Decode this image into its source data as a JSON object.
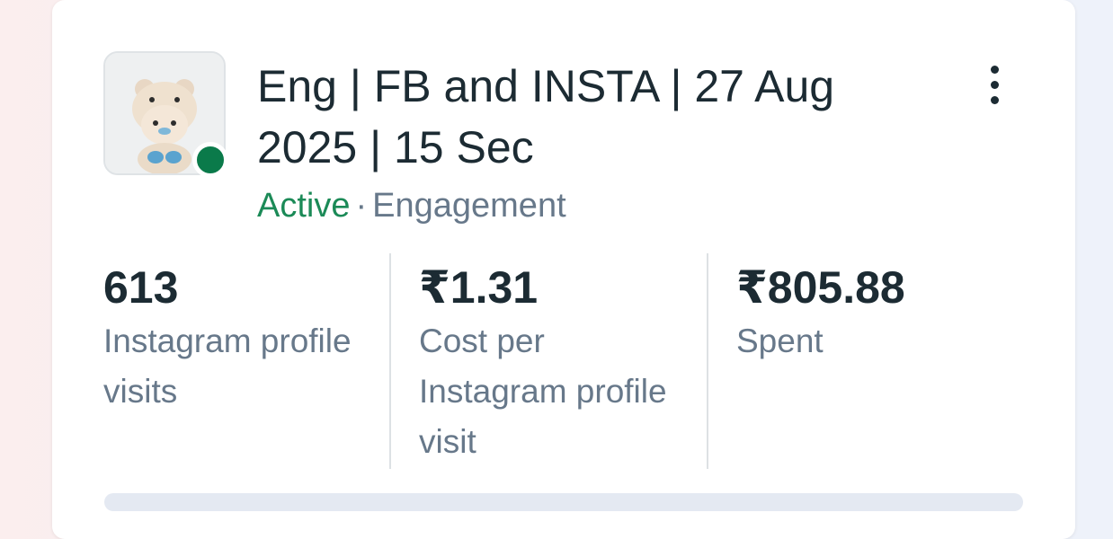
{
  "campaign": {
    "title": "Eng | FB and INSTA | 27 Aug 2025 | 15 Sec",
    "status": "Active",
    "separator": "·",
    "objective": "Engagement",
    "status_color": "#0a7a4a"
  },
  "thumbnail": {
    "icon": "bear-mascot-thumbnail"
  },
  "menu": {
    "icon": "more-vertical-icon"
  },
  "metrics": [
    {
      "value": "613",
      "label": "Instagram profile visits"
    },
    {
      "value": "₹1.31",
      "label": "Cost per Instagram profile visit"
    },
    {
      "value": "₹805.88",
      "label": "Spent"
    }
  ]
}
